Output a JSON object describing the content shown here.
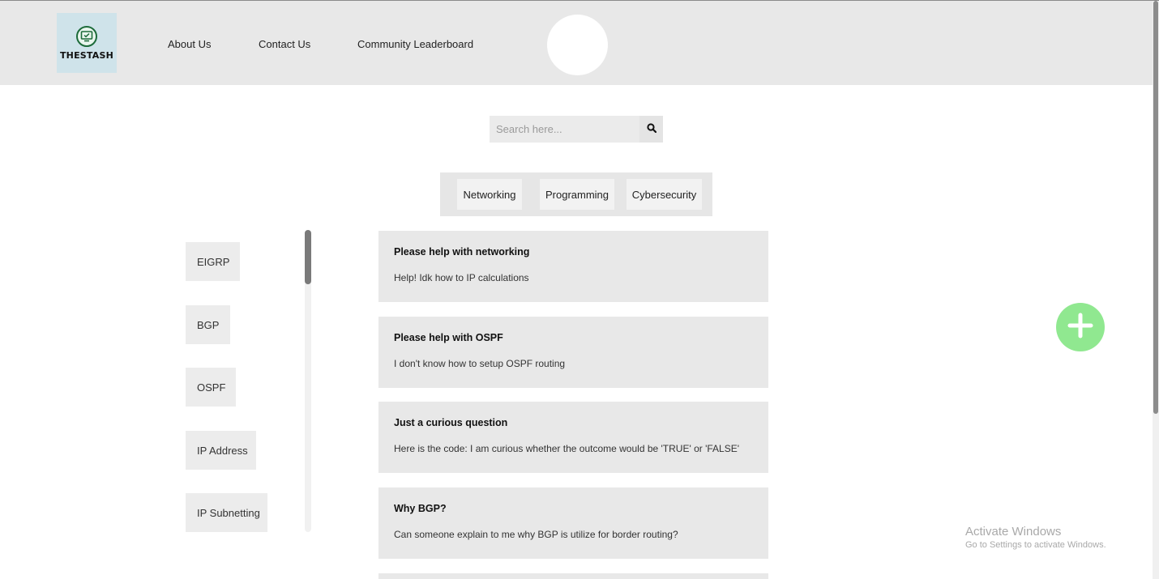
{
  "brand": {
    "logo_text": "THESTASH",
    "logo_color": "#1d6b3a"
  },
  "nav": {
    "items": [
      {
        "label": "About Us"
      },
      {
        "label": "Contact Us"
      },
      {
        "label": "Community Leaderboard"
      }
    ]
  },
  "search": {
    "placeholder": "Search here...",
    "icon": "search-icon"
  },
  "categories": [
    {
      "label": "Networking"
    },
    {
      "label": "Programming"
    },
    {
      "label": "Cybersecurity"
    }
  ],
  "topics": [
    {
      "label": "EIGRP"
    },
    {
      "label": "BGP"
    },
    {
      "label": "OSPF"
    },
    {
      "label": "IP Address"
    },
    {
      "label": "IP Subnetting"
    }
  ],
  "posts": [
    {
      "title": "Please help with networking",
      "body": "Help! Idk how to IP calculations"
    },
    {
      "title": "Please help with OSPF",
      "body": "I don't know how to setup OSPF routing"
    },
    {
      "title": "Just a curious question",
      "body": "Here is the code: I am curious whether the outcome would be 'TRUE' or 'FALSE'"
    },
    {
      "title": "Why BGP?",
      "body": "Can someone explain to me why BGP is utilize for border routing?"
    }
  ],
  "fab": {
    "icon": "plus-icon",
    "color": "#90e890"
  },
  "watermark": {
    "title": "Activate Windows",
    "subtitle": "Go to Settings to activate Windows."
  }
}
